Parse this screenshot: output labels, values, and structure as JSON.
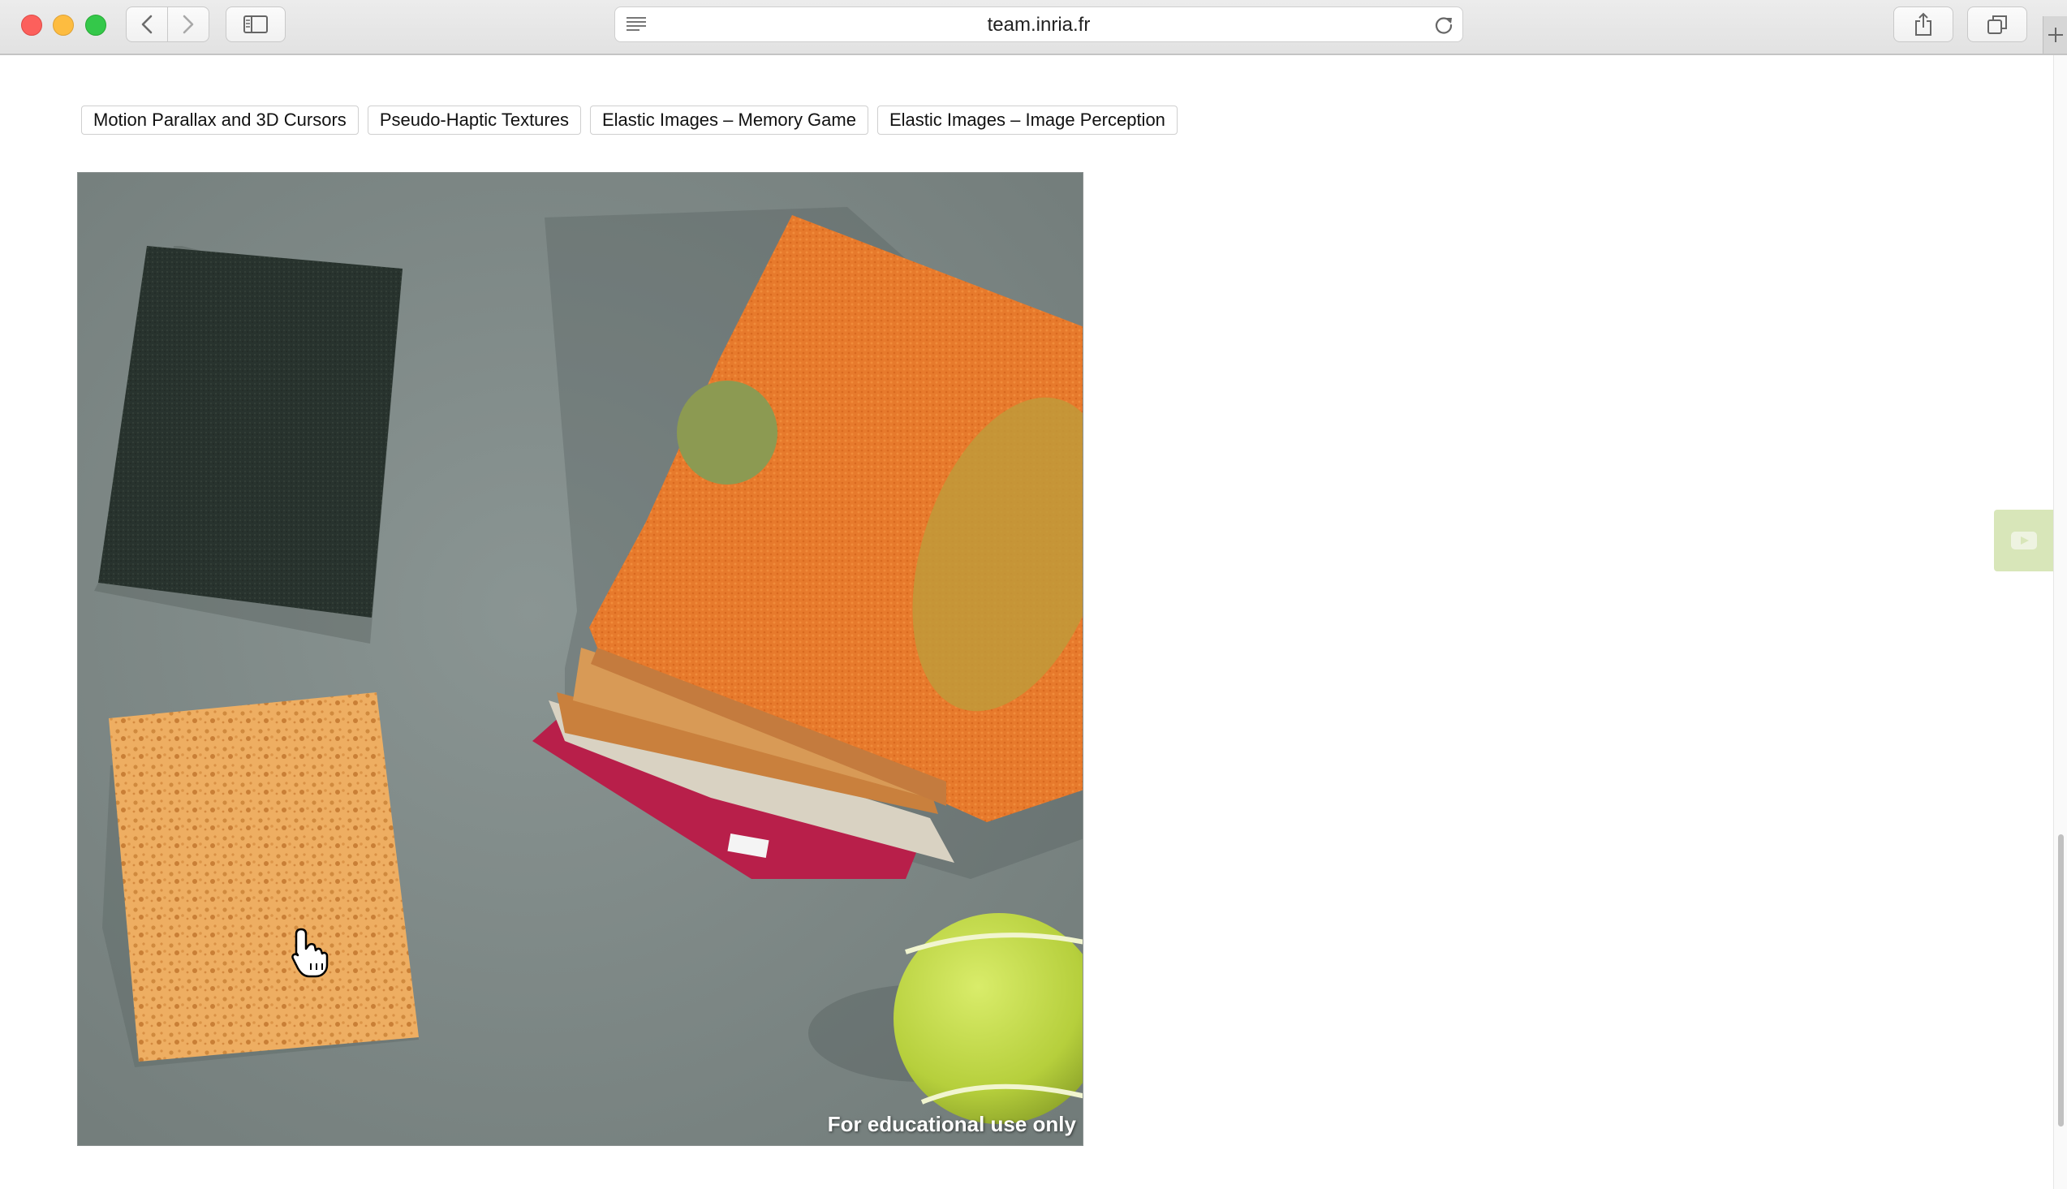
{
  "browser": {
    "url": "team.inria.fr"
  },
  "tabs": [
    {
      "label": "Motion Parallax and 3D Cursors"
    },
    {
      "label": "Pseudo-Haptic Textures"
    },
    {
      "label": "Elastic Images – Memory Game"
    },
    {
      "label": "Elastic Images – Image Perception"
    }
  ],
  "image": {
    "watermark": "For educational use only"
  },
  "icons": {
    "reader": "reader-icon",
    "reload": "reload-icon",
    "share": "share-icon",
    "tabs": "tabs-overview-icon",
    "sidebar": "sidebar-icon",
    "back": "chevron-left-icon",
    "forward": "chevron-right-icon",
    "video": "video-icon",
    "cursor": "hand-cursor-icon"
  },
  "colors": {
    "widget": "#d8e6b9"
  }
}
